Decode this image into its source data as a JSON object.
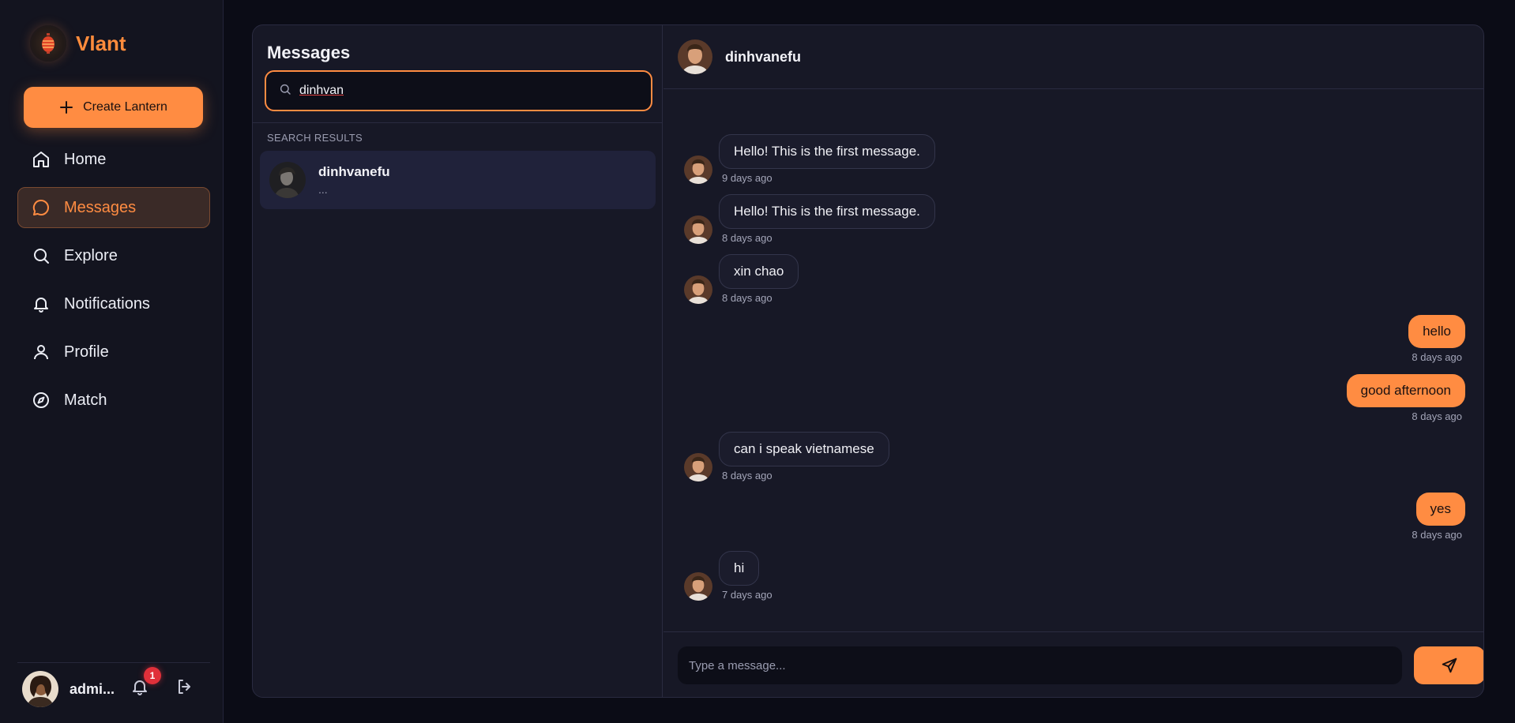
{
  "app": {
    "name": "Vlant"
  },
  "sidebar": {
    "create_button": "Create Lantern",
    "items": [
      {
        "label": "Home",
        "icon": "home-icon"
      },
      {
        "label": "Messages",
        "icon": "message-icon",
        "active": true
      },
      {
        "label": "Explore",
        "icon": "search-icon"
      },
      {
        "label": "Notifications",
        "icon": "bell-icon"
      },
      {
        "label": "Profile",
        "icon": "user-icon"
      },
      {
        "label": "Match",
        "icon": "compass-icon"
      }
    ],
    "user": {
      "name": "admi...",
      "notification_count": "1"
    }
  },
  "messages_pane": {
    "title": "Messages",
    "search": {
      "value": "dinhvan"
    },
    "section_label": "SEARCH RESULTS",
    "results": [
      {
        "name": "dinhvanefu",
        "preview": "..."
      }
    ]
  },
  "chat": {
    "contact_name": "dinhvanefu",
    "messages": [
      {
        "direction": "in",
        "text": "Hello! This is the first message.",
        "time": "9 days ago"
      },
      {
        "direction": "in",
        "text": "Hello! This is the first message.",
        "time": "8 days ago"
      },
      {
        "direction": "in",
        "text": "xin chao",
        "time": "8 days ago"
      },
      {
        "direction": "out",
        "text": "hello",
        "time": "8 days ago"
      },
      {
        "direction": "out",
        "text": "good afternoon",
        "time": "8 days ago"
      },
      {
        "direction": "in",
        "text": "can i speak vietnamese",
        "time": "8 days ago"
      },
      {
        "direction": "out",
        "text": "yes",
        "time": "8 days ago"
      },
      {
        "direction": "in",
        "text": "hi",
        "time": "7 days ago"
      }
    ],
    "composer": {
      "placeholder": "Type a message..."
    }
  },
  "colors": {
    "accent": "#ff8c42",
    "background": "#0b0c16",
    "panel": "#171826",
    "badge": "#e0303a"
  }
}
